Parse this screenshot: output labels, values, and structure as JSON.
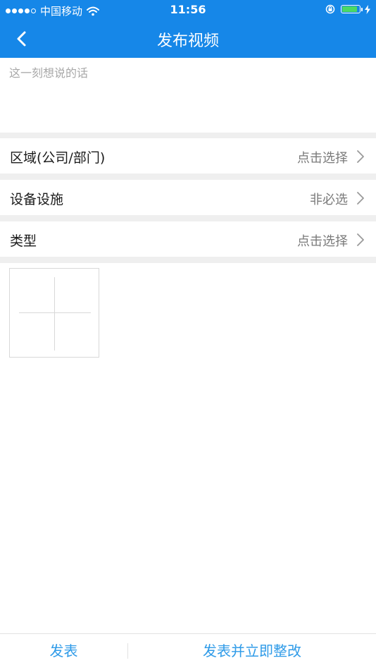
{
  "status_bar": {
    "carrier": "中国移动",
    "time": "11:56",
    "signal_strength": 4,
    "signal_max": 5,
    "battery_level": 0.9,
    "battery_color": "#4cd964"
  },
  "nav": {
    "title": "发布视频",
    "back_icon": "chevron-left-icon",
    "background_color": "#1687e8"
  },
  "description": {
    "placeholder": "这一刻想说的话",
    "value": ""
  },
  "fields": [
    {
      "label": "区域(公司/部门)",
      "value": "点击选择",
      "icon": "chevron-right-icon"
    },
    {
      "label": "设备设施",
      "value": "非必选",
      "icon": "chevron-right-icon"
    },
    {
      "label": "类型",
      "value": "点击选择",
      "icon": "chevron-right-icon"
    }
  ],
  "media": {
    "add_icon": "plus-icon"
  },
  "actions": {
    "publish_label": "发表",
    "publish_rectify_label": "发表并立即整改",
    "accent_color": "#2f9be8"
  }
}
